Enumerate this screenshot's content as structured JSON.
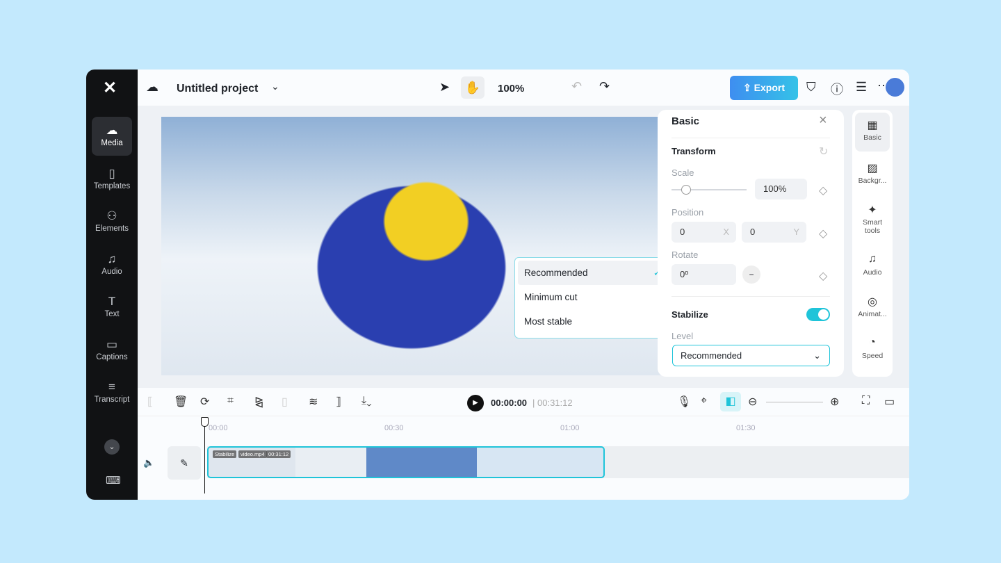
{
  "project": {
    "title": "Untitled project",
    "zoom": "100%"
  },
  "sidebar": {
    "items": [
      {
        "label": "Media",
        "icon": "cloud-upload-icon"
      },
      {
        "label": "Templates",
        "icon": "templates-icon"
      },
      {
        "label": "Elements",
        "icon": "elements-icon"
      },
      {
        "label": "Audio",
        "icon": "music-icon"
      },
      {
        "label": "Text",
        "icon": "text-icon"
      },
      {
        "label": "Captions",
        "icon": "captions-icon"
      },
      {
        "label": "Transcript",
        "icon": "transcript-icon"
      }
    ]
  },
  "toolbar": {
    "export_label": "Export"
  },
  "dropdown": {
    "options": [
      "Recommended",
      "Minimum cut",
      "Most stable"
    ],
    "selected": "Recommended"
  },
  "panel": {
    "title": "Basic",
    "transform": "Transform",
    "scale_label": "Scale",
    "scale_value": "100%",
    "scale_fraction": 0.1,
    "position_label": "Position",
    "pos_x": "0",
    "pos_x_unit": "X",
    "pos_y": "0",
    "pos_y_unit": "Y",
    "rotate_label": "Rotate",
    "rotate_value": "0º",
    "stabilize_label": "Stabilize",
    "stabilize_on": true,
    "level_label": "Level",
    "level_value": "Recommended"
  },
  "right_tabs": [
    {
      "label": "Basic"
    },
    {
      "label": "Backgr..."
    },
    {
      "label": "Smart tools"
    },
    {
      "label": "Audio"
    },
    {
      "label": "Animat..."
    },
    {
      "label": "Speed"
    }
  ],
  "timeline": {
    "current": "00:00:00",
    "total": "00:31:12",
    "ticks": [
      "00:00",
      "00:30",
      "01:00",
      "01:30"
    ],
    "clip_tags": [
      "Stabilize",
      "video.mp4",
      "00:31:12"
    ]
  },
  "colors": {
    "accent": "#1fc4d9",
    "export": "#3e8ef0"
  }
}
